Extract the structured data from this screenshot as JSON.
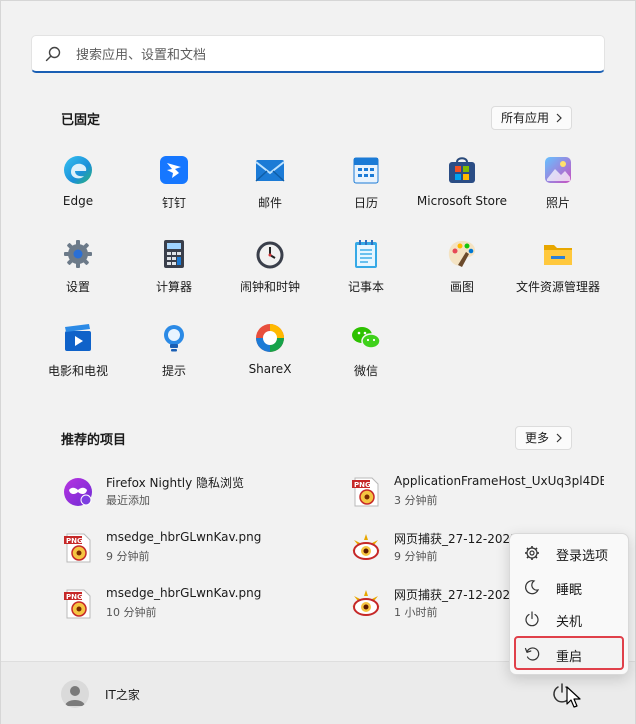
{
  "search": {
    "placeholder": "搜索应用、设置和文档"
  },
  "pinned": {
    "title": "已固定",
    "all_apps_label": "所有应用",
    "apps": [
      {
        "label": "Edge",
        "icon": "edge-icon"
      },
      {
        "label": "钉钉",
        "icon": "dingtalk-icon"
      },
      {
        "label": "邮件",
        "icon": "mail-icon"
      },
      {
        "label": "日历",
        "icon": "calendar-icon"
      },
      {
        "label": "Microsoft Store",
        "icon": "store-icon"
      },
      {
        "label": "照片",
        "icon": "photos-icon"
      },
      {
        "label": "设置",
        "icon": "gear-icon"
      },
      {
        "label": "计算器",
        "icon": "calculator-icon"
      },
      {
        "label": "闹钟和时钟",
        "icon": "clock-icon"
      },
      {
        "label": "记事本",
        "icon": "notepad-icon"
      },
      {
        "label": "画图",
        "icon": "paint-icon"
      },
      {
        "label": "文件资源管理器",
        "icon": "folder-icon"
      },
      {
        "label": "电影和电视",
        "icon": "movies-icon"
      },
      {
        "label": "提示",
        "icon": "tips-icon"
      },
      {
        "label": "ShareX",
        "icon": "sharex-icon"
      },
      {
        "label": "微信",
        "icon": "wechat-icon"
      }
    ]
  },
  "recommended": {
    "title": "推荐的项目",
    "more_label": "更多",
    "items": [
      {
        "name": "Firefox Nightly 隐私浏览",
        "time": "最近添加",
        "icon": "firefox-private-icon"
      },
      {
        "name": "ApplicationFrameHost_UxUq3pl4DE...",
        "time": "3 分钟前",
        "icon": "png-file-icon"
      },
      {
        "name": "msedge_hbrGLwnKav.png",
        "time": "9 分钟前",
        "icon": "png-file-icon"
      },
      {
        "name": "网页捕获_27-12-2022...",
        "time": "9 分钟前",
        "icon": "image-viewer-icon"
      },
      {
        "name": "msedge_hbrGLwnKav.png",
        "time": "10 分钟前",
        "icon": "png-file-icon"
      },
      {
        "name": "网页捕获_27-12-2022...",
        "time": "1 小时前",
        "icon": "image-viewer-icon"
      }
    ]
  },
  "user": {
    "name": "IT之家"
  },
  "power_menu": {
    "items": [
      {
        "label": "登录选项",
        "icon": "gear-icon"
      },
      {
        "label": "睡眠",
        "icon": "moon-icon"
      },
      {
        "label": "关机",
        "icon": "power-icon"
      },
      {
        "label": "重启",
        "icon": "restart-icon"
      }
    ],
    "highlight_color": "#e0404a"
  },
  "colors": {
    "accent": "#1a5fb4"
  }
}
